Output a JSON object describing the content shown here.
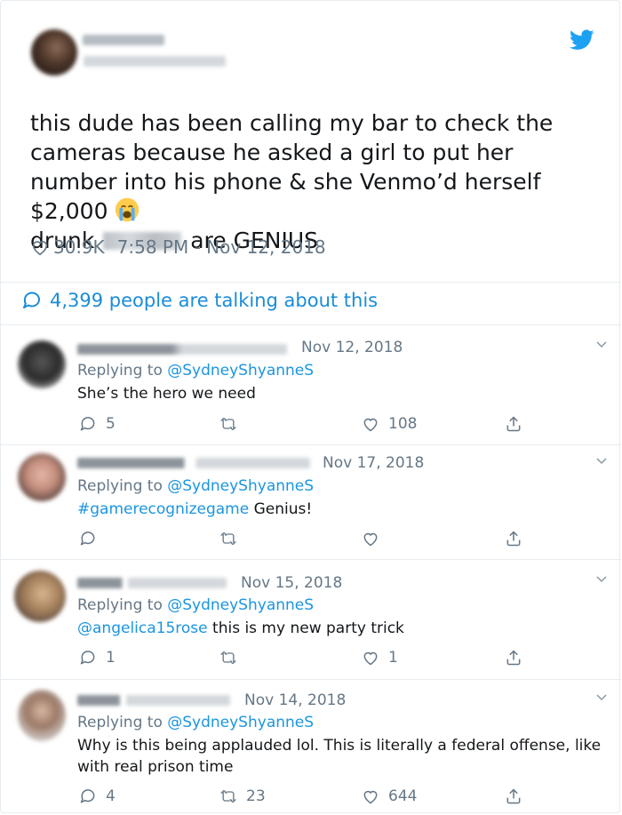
{
  "tweet": {
    "text_part1": "this dude has been calling my bar to check the cameras because he asked a girl to put her number into his phone & she Venmo’d herself $2,000",
    "text_part2": "drunk",
    "text_part3": "are GENIUS",
    "likes": "30.9K",
    "timestamp": "7:58 PM - Nov 12, 2018",
    "talking": "4,399 people are talking about this",
    "icons": [
      "twitter-bird-icon",
      "heart-icon",
      "comment-bubble-icon",
      "crying-emoji-icon"
    ],
    "accent_color": "#1da1f2"
  },
  "replies": [
    {
      "date": "Nov 12, 2018",
      "replying_prefix": "Replying to",
      "replying_handle": "@SydneyShyanneS",
      "tag": "",
      "body": "She’s the hero we need",
      "replies_count": "5",
      "retweets_count": "",
      "likes_count": "108"
    },
    {
      "date": "Nov 17, 2018",
      "replying_prefix": "Replying to",
      "replying_handle": "@SydneyShyanneS",
      "tag": "#gamerecognizegame",
      "body": " Genius!",
      "replies_count": "",
      "retweets_count": "",
      "likes_count": ""
    },
    {
      "date": "Nov 15, 2018",
      "replying_prefix": "Replying to",
      "replying_handle": "@SydneyShyanneS",
      "tag": "@angelica15rose",
      "body": " this is my new party trick",
      "replies_count": "1",
      "retweets_count": "",
      "likes_count": "1"
    },
    {
      "date": "Nov 14, 2018",
      "replying_prefix": "Replying to",
      "replying_handle": "@SydneyShyanneS",
      "tag": "",
      "body": "Why is this being applauded lol. This is literally a federal offense, like with real prison time",
      "replies_count": "4",
      "retweets_count": "23",
      "likes_count": "644"
    }
  ]
}
